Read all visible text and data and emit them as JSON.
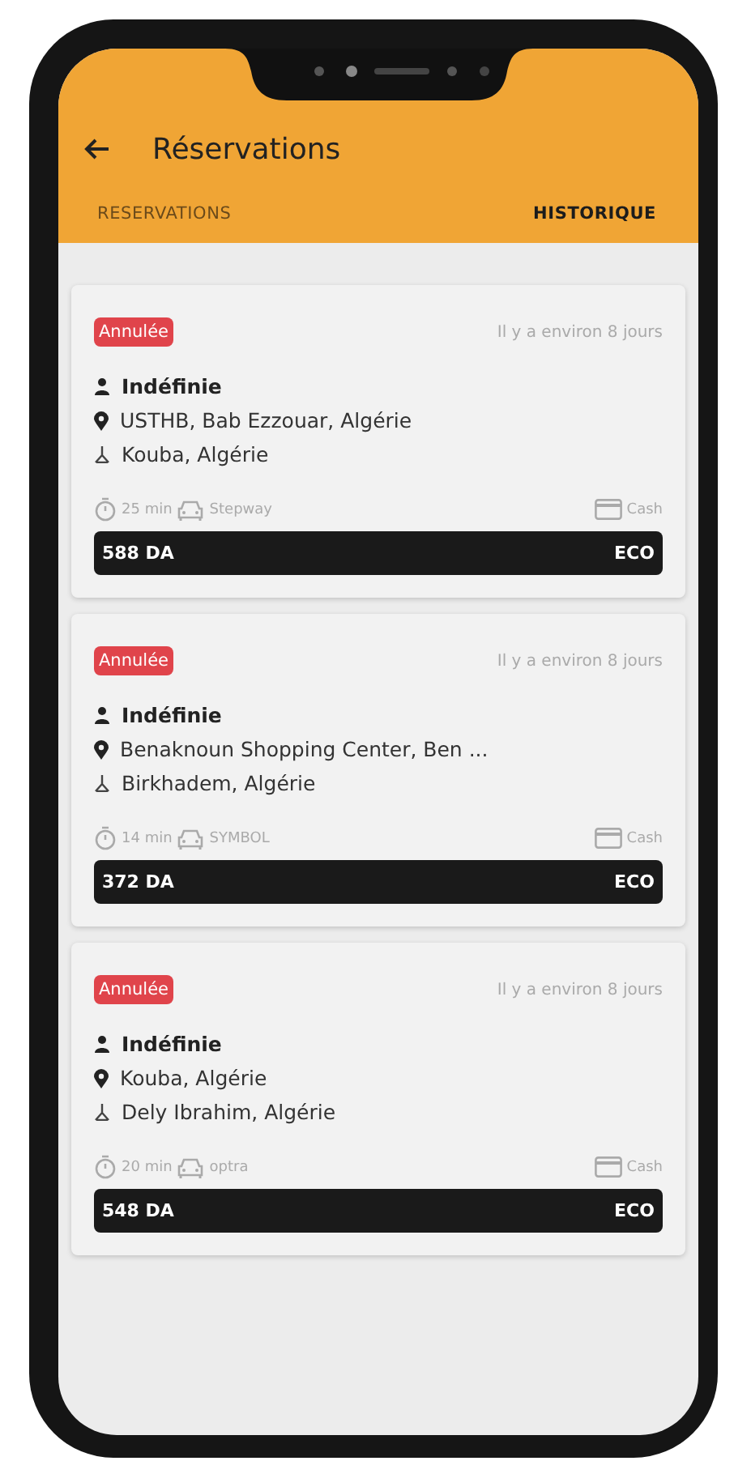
{
  "header": {
    "title": "Réservations"
  },
  "tabs": [
    {
      "label": "RESERVATIONS",
      "selected": false
    },
    {
      "label": "HISTORIQUE",
      "selected": true
    }
  ],
  "reservations": [
    {
      "status": "Annulée",
      "time": "Il y a environ 8 jours",
      "passenger": "Indéfinie",
      "pickup": "USTHB, Bab Ezzouar, Algérie",
      "dropoff": "Kouba, Algérie",
      "duration": "25 min",
      "vehicle": "Stepway",
      "payment": "Cash",
      "price": "588 DA",
      "category": "ECO"
    },
    {
      "status": "Annulée",
      "time": "Il y a environ 8 jours",
      "passenger": "Indéfinie",
      "pickup": "Benaknoun Shopping Center, Ben ...",
      "dropoff": "Birkhadem, Algérie",
      "duration": "14 min",
      "vehicle": "SYMBOL",
      "payment": "Cash",
      "price": "372 DA",
      "category": "ECO"
    },
    {
      "status": "Annulée",
      "time": "Il y a environ 8 jours",
      "passenger": "Indéfinie",
      "pickup": "Kouba, Algérie",
      "dropoff": "Dely Ibrahim, Algérie",
      "duration": "20 min",
      "vehicle": "optra",
      "payment": "Cash",
      "price": "548 DA",
      "category": "ECO"
    }
  ]
}
